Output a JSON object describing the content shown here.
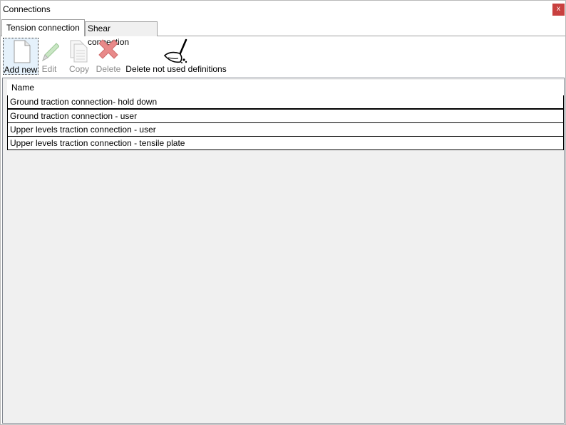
{
  "window": {
    "title": "Connections",
    "close_label": "x"
  },
  "tabs": [
    {
      "label": "Tension connection",
      "active": true
    },
    {
      "label": "Shear connection",
      "active": false
    }
  ],
  "toolbar": {
    "add_new": "Add new",
    "edit": "Edit",
    "copy": "Copy",
    "delete": "Delete",
    "delete_unused": "Delete not used definitions"
  },
  "icons": {
    "add_new": "blank-document-icon",
    "edit": "pencil-icon",
    "copy": "copy-documents-icon",
    "delete": "red-x-icon",
    "delete_unused": "broom-icon"
  },
  "grid": {
    "header": "Name",
    "rows": [
      "Ground traction connection- hold down",
      "Ground traction connection - user",
      "Upper levels traction connection - user",
      "Upper levels traction connection - tensile plate"
    ]
  },
  "colors": {
    "close_button": "#c8403f",
    "delete_icon": "#e05a5a",
    "selected_button": "#e5f1fb"
  }
}
